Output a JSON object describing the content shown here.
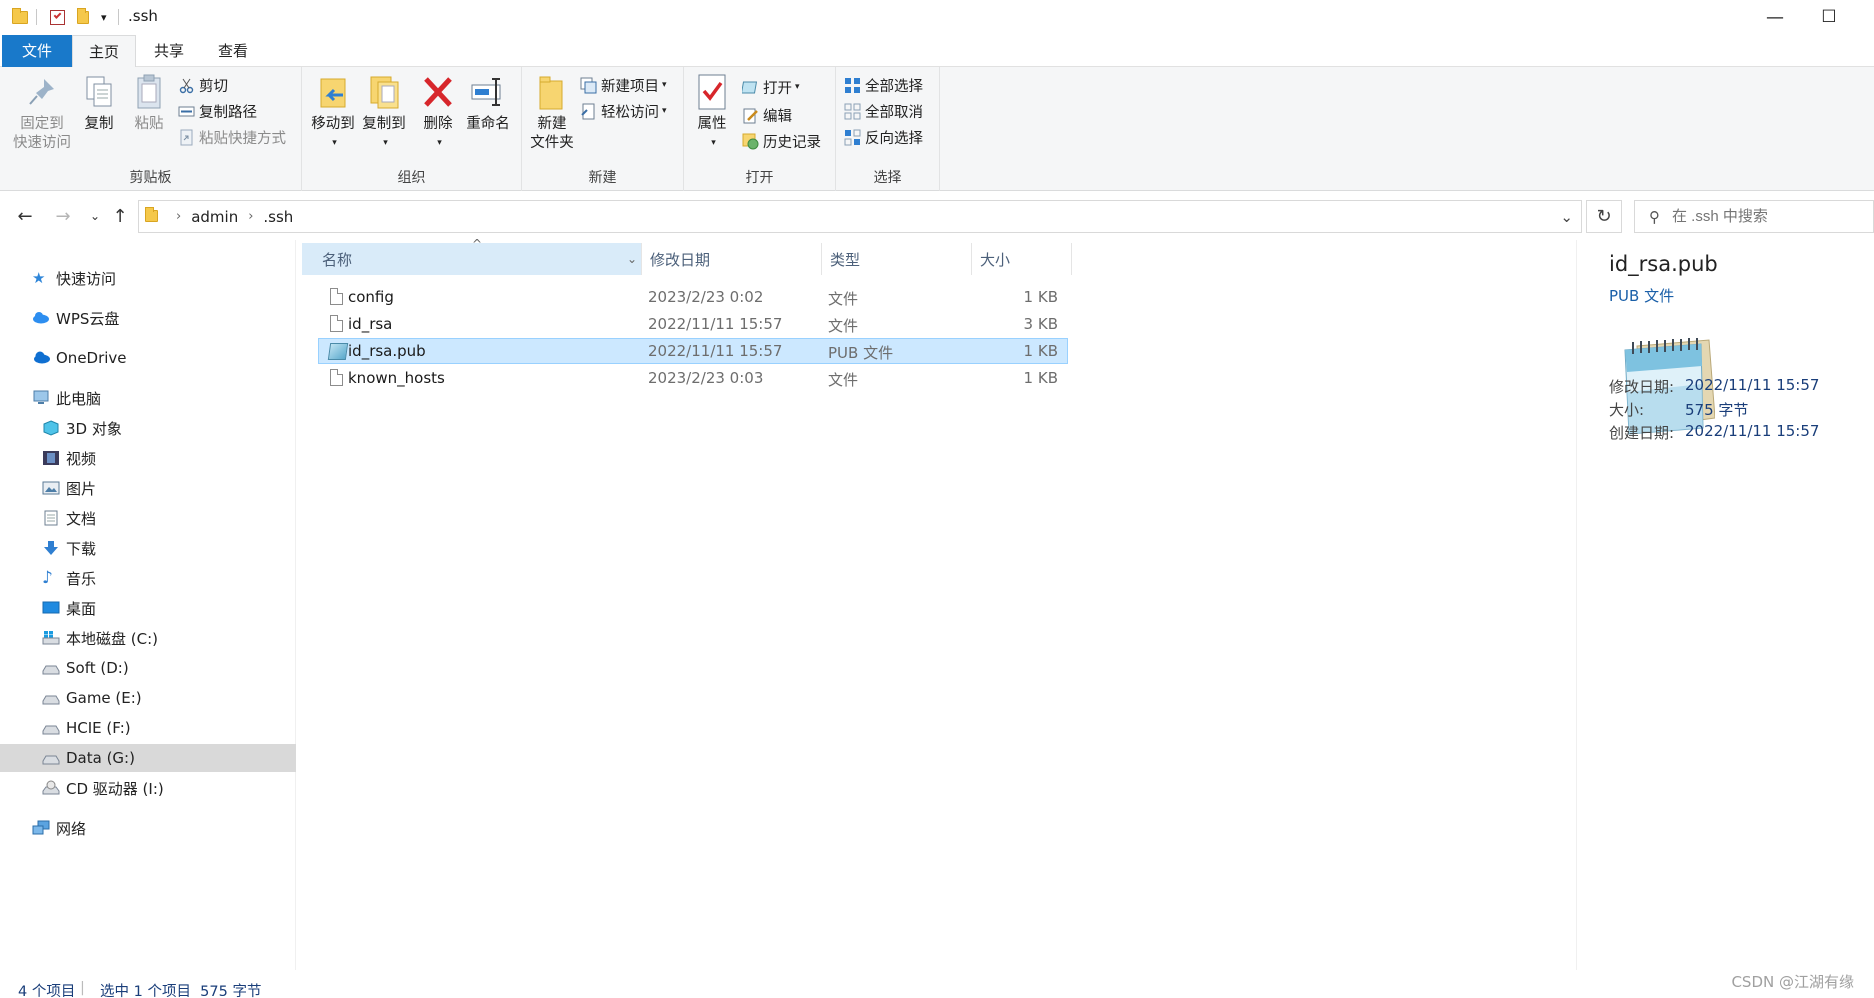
{
  "title_bar": {
    "path_title": ".ssh",
    "minimize_glyph": "—",
    "maximize_glyph": "☐"
  },
  "tabs": [
    "文件",
    "主页",
    "共享",
    "查看"
  ],
  "ribbon": {
    "clipboard": {
      "label": "剪贴板",
      "pin_line1": "固定到",
      "pin_line2": "快速访问",
      "copy": "复制",
      "paste": "粘贴",
      "cut": "剪切",
      "copy_path": "复制路径",
      "paste_shortcut": "粘贴快捷方式"
    },
    "organize": {
      "label": "组织",
      "move_to": "移动到",
      "copy_to": "复制到",
      "delete": "删除",
      "rename": "重命名"
    },
    "new": {
      "label": "新建",
      "new_folder_line1": "新建",
      "new_folder_line2": "文件夹",
      "new_item": "新建项目",
      "easy_access": "轻松访问"
    },
    "open": {
      "label": "打开",
      "properties": "属性",
      "open": "打开",
      "edit": "编辑",
      "history": "历史记录"
    },
    "select": {
      "label": "选择",
      "select_all": "全部选择",
      "select_none": "全部取消",
      "invert": "反向选择"
    }
  },
  "address": {
    "crumbs": [
      "admin",
      ".ssh"
    ],
    "search_placeholder": "在 .ssh 中搜索"
  },
  "nav": {
    "quick_access": "快速访问",
    "wps": "WPS云盘",
    "onedrive": "OneDrive",
    "this_pc": "此电脑",
    "items": [
      "3D 对象",
      "视频",
      "图片",
      "文档",
      "下载",
      "音乐",
      "桌面",
      "本地磁盘 (C:)",
      "Soft (D:)",
      "Game (E:)",
      "HCIE (F:)",
      "Data (G:)",
      "CD 驱动器 (I:)"
    ],
    "network": "网络"
  },
  "columns": {
    "name": "名称",
    "date": "修改日期",
    "type": "类型",
    "size": "大小"
  },
  "files": [
    {
      "name": "config",
      "date": "2023/2/23 0:02",
      "type": "文件",
      "size": "1 KB"
    },
    {
      "name": "id_rsa",
      "date": "2022/11/11 15:57",
      "type": "文件",
      "size": "3 KB"
    },
    {
      "name": "id_rsa.pub",
      "date": "2022/11/11 15:57",
      "type": "PUB 文件",
      "size": "1 KB"
    },
    {
      "name": "known_hosts",
      "date": "2023/2/23 0:03",
      "type": "文件",
      "size": "1 KB"
    }
  ],
  "details": {
    "name": "id_rsa.pub",
    "type": "PUB 文件",
    "modified_label": "修改日期:",
    "modified_value": "2022/11/11 15:57",
    "size_label": "大小:",
    "size_value": "575 字节",
    "created_label": "创建日期:",
    "created_value": "2022/11/11 15:57"
  },
  "status": {
    "count": "4 个项目",
    "selection": "选中 1 个项目  575 字节"
  },
  "watermark": "CSDN @江湖有缘",
  "colors": {
    "file_tab": "#1979ca",
    "selection": "#cce8ff",
    "link_blue": "#1a5fa8"
  }
}
